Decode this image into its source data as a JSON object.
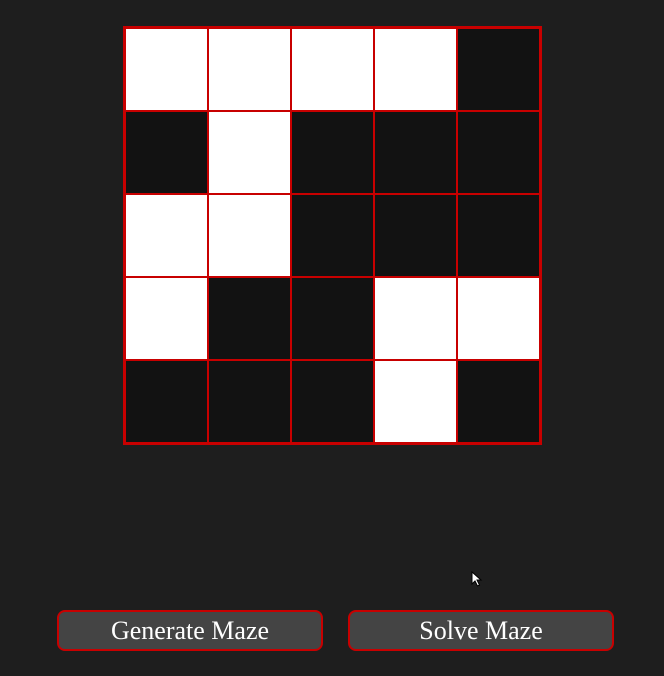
{
  "maze": {
    "rows": [
      [
        "open",
        "open",
        "open",
        "open",
        "wall"
      ],
      [
        "wall",
        "open",
        "wall",
        "wall",
        "wall"
      ],
      [
        "open",
        "open",
        "wall",
        "wall",
        "wall"
      ],
      [
        "open",
        "wall",
        "wall",
        "open",
        "open"
      ],
      [
        "wall",
        "wall",
        "wall",
        "open",
        "wall"
      ]
    ],
    "colors": {
      "open": "#ffffff",
      "wall": "#121212",
      "border": "#c80000",
      "background": "#1e1e1e",
      "button": "#444444"
    }
  },
  "controls": {
    "generate_label": "Generate Maze",
    "solve_label": "Solve Maze"
  },
  "pointer": {
    "icon": "mouse-pointer-icon"
  }
}
